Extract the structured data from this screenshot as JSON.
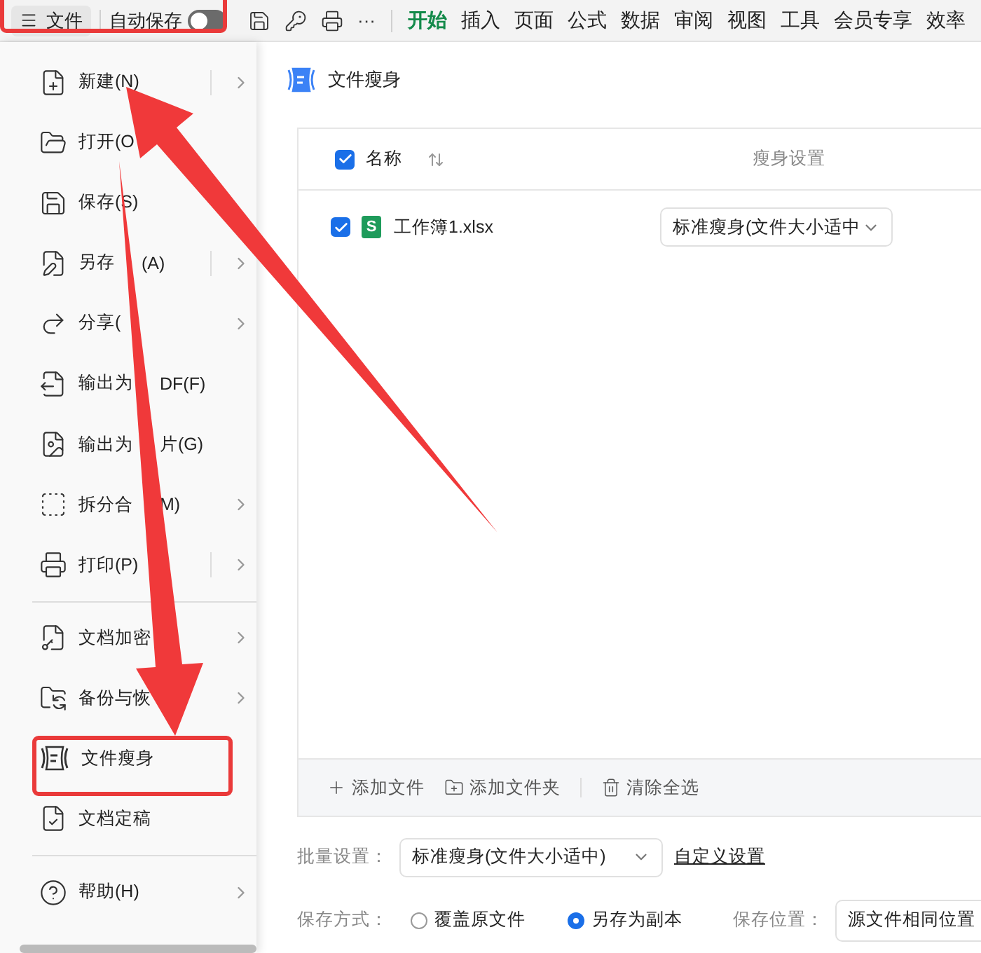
{
  "toolbar": {
    "file_menu": "文件",
    "autosave": {
      "label": "自动保存",
      "on": false
    },
    "more": "···",
    "tabs": [
      {
        "label": "开始",
        "selected": true
      },
      {
        "label": "插入",
        "selected": false
      },
      {
        "label": "页面",
        "selected": false
      },
      {
        "label": "公式",
        "selected": false
      },
      {
        "label": "数据",
        "selected": false
      },
      {
        "label": "审阅",
        "selected": false
      },
      {
        "label": "视图",
        "selected": false
      },
      {
        "label": "工具",
        "selected": false
      },
      {
        "label": "会员专享",
        "selected": false
      },
      {
        "label": "效率",
        "selected": false
      }
    ]
  },
  "file_menu": {
    "groups": [
      [
        {
          "kind": "new",
          "label": "新建(N)",
          "submenu": true,
          "split": true
        },
        {
          "kind": "open",
          "label": "打开(O",
          "submenu": false,
          "split": false
        },
        {
          "kind": "save",
          "label": "保存(S)",
          "submenu": false,
          "split": false
        },
        {
          "kind": "save_as",
          "label": "另存",
          "tail": "(A)",
          "submenu": true,
          "split": true
        },
        {
          "kind": "share",
          "label": "分享(",
          "submenu": true,
          "split": false
        },
        {
          "kind": "pdf",
          "label": "输出为",
          "tail": "DF(F)",
          "submenu": false,
          "split": false
        },
        {
          "kind": "image",
          "label": "输出为",
          "tail": "片(G)",
          "submenu": false,
          "split": false
        },
        {
          "kind": "split",
          "label": "拆分合",
          "tail": "M)",
          "submenu": true,
          "split": false
        },
        {
          "kind": "print",
          "label": "打印(P)",
          "submenu": true,
          "split": true
        }
      ],
      [
        {
          "kind": "encrypt",
          "label": "文档加密",
          "submenu": true,
          "split": false
        },
        {
          "kind": "backup",
          "label": "备份与恢",
          "submenu": true,
          "split": false
        },
        {
          "kind": "slim",
          "label": "文件瘦身",
          "submenu": false,
          "split": false
        },
        {
          "kind": "finalize",
          "label": "文档定稿",
          "submenu": false,
          "split": false
        }
      ],
      [
        {
          "kind": "help",
          "label": "帮助(H)",
          "submenu": true,
          "split": false
        }
      ]
    ]
  },
  "panel": {
    "title": "文件瘦身",
    "table": {
      "select_all": true,
      "columns": [
        "名称",
        "瘦身设置"
      ],
      "rows": [
        {
          "checked": true,
          "badge": "S",
          "file": "工作簿1.xlsx",
          "setting": "标准瘦身(文件大小适中"
        }
      ],
      "actions": [
        {
          "kind": "add_file",
          "label": "添加文件"
        },
        {
          "kind": "add_folder",
          "label": "添加文件夹"
        },
        {
          "kind": "clear",
          "label": "清除全选"
        }
      ]
    },
    "batch": {
      "label": "批量设置：",
      "value": "标准瘦身(文件大小适中)",
      "link": "自定义设置"
    },
    "save": {
      "label": "保存方式：",
      "options": [
        {
          "label": "覆盖原文件",
          "selected": false
        },
        {
          "label": "另存为副本",
          "selected": true
        }
      ],
      "location_label": "保存位置：",
      "location": "源文件相同位置"
    }
  }
}
